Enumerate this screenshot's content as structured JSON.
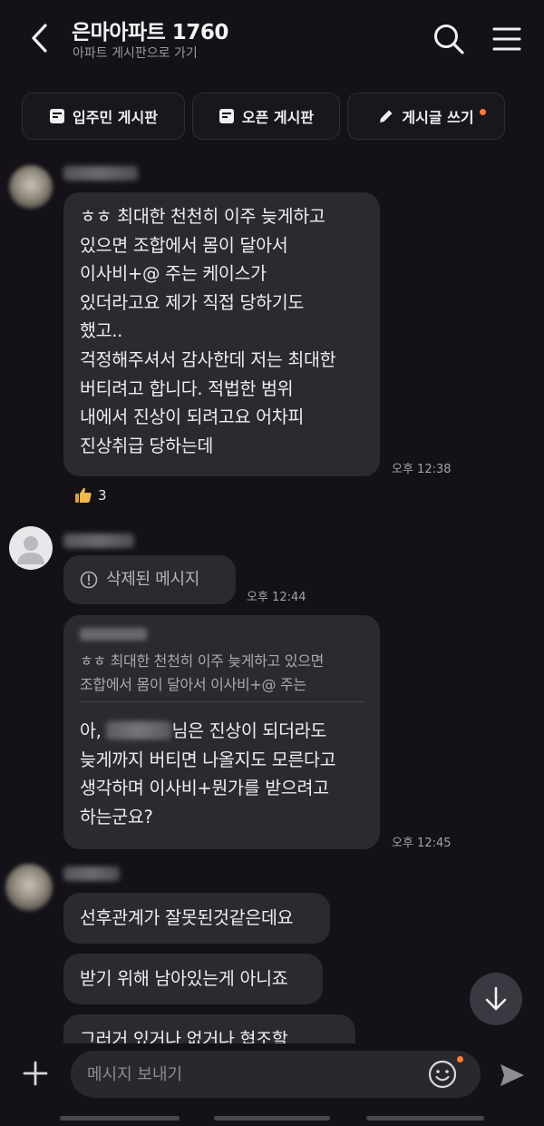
{
  "header": {
    "title": "은마아파트 1760",
    "subtitle": "아파트 게시판으로 가기"
  },
  "boards": [
    {
      "label": "입주민 게시판"
    },
    {
      "label": "오픈 게시판"
    },
    {
      "label": "게시글 쓰기"
    }
  ],
  "messages": {
    "m1": {
      "lines": [
        "ㅎㅎ 최대한 천천히 이주 늦게하고",
        "있으면 조합에서 몸이 달아서",
        "이사비+@  주는 케이스가",
        "있더라고요 제가 직접 당하기도",
        "했고..",
        "걱정해주셔서 감사한데 저는 최대한",
        "버티려고 합니다. 적법한 범위",
        "내에서 진상이 되려고요 어차피",
        "진상취급 당하는데"
      ],
      "time": "오후 12:38",
      "reaction_count": "3"
    },
    "m2": {
      "deleted_label": "삭제된 메시지",
      "time": "오후 12:44"
    },
    "m3": {
      "quote_lines": [
        "ㅎㅎ 최대한 천천히 이주 늦게하고 있으면",
        "조합에서 몸이 달아서 이사비+@  주는"
      ],
      "reply_line1_prefix": "아, ",
      "reply_line1_suffix": "님은 진상이 되더라도",
      "reply_lines": [
        "늦게까지 버티면 나올지도 모른다고",
        "생각하며 이사비+뭔가를 받으려고",
        "하는군요?"
      ],
      "time": "오후 12:45"
    },
    "m4": {
      "text": "선후관계가 잘못된것같은데요"
    },
    "m5": {
      "text": "받기 위해 남아있는게 아니죠"
    },
    "m6": {
      "text": "그러거 있거나 없거나 협조할"
    }
  },
  "input": {
    "placeholder": "메시지 보내기"
  },
  "colors": {
    "background": "#141218",
    "bubble": "#2c2a31",
    "notification_dot": "#ff7a33"
  }
}
